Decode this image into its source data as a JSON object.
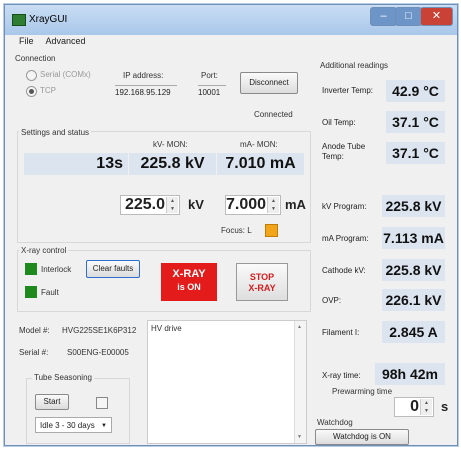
{
  "window": {
    "title": "XrayGUI"
  },
  "menu": {
    "file": "File",
    "advanced": "Advanced"
  },
  "connection": {
    "group_label": "Connection",
    "serial_label": "Serial (COMx)",
    "tcp_label": "TCP",
    "ip_label": "IP address:",
    "ip_value": "192.168.95.129",
    "port_label": "Port:",
    "port_value": "10001",
    "disconnect_label": "Disconnect",
    "status": "Connected"
  },
  "settings": {
    "group_label": "Settings and status",
    "kv_mon_label": "kV- MON:",
    "ma_mon_label": "mA- MON:",
    "time_value": "13s",
    "kv_mon_value": "225.8 kV",
    "ma_mon_value": "7.010 mA",
    "kv_set_value": "225.0",
    "kv_unit": "kV",
    "ma_set_value": "7.000",
    "ma_unit": "mA",
    "focus_label": "Focus: L",
    "focus_color": "#f2a51a"
  },
  "xray_control": {
    "group_label": "X-ray control",
    "interlock_label": "Interlock",
    "fault_label": "Fault",
    "clear_faults_label": "Clear faults",
    "xray_on_line1": "X-RAY",
    "xray_on_line2": "is ON",
    "stop_line1": "STOP",
    "stop_line2": "X-RAY",
    "led_color": "#1e8a1e",
    "on_color": "#e41b1b"
  },
  "model": {
    "model_label": "Model #:",
    "model_value": "HVG225SE1K6P312",
    "serial_label": "Serial #:",
    "serial_value": "S00ENG-E00005",
    "hv_drive_label": "HV drive"
  },
  "tube_seasoning": {
    "group_label": "Tube Seasoning",
    "start_label": "Start",
    "select_value": "Idle 3 - 30 days"
  },
  "readings": {
    "group_label": "Additional readings",
    "inverter_temp_label": "Inverter Temp:",
    "inverter_temp_value": "42.9 °C",
    "oil_temp_label": "Oil Temp:",
    "oil_temp_value": "37.1 °C",
    "anode_temp_label": "Anode Tube Temp:",
    "anode_temp_value": "37.1 °C",
    "kv_program_label": "kV Program:",
    "kv_program_value": "225.8 kV",
    "ma_program_label": "mA Program:",
    "ma_program_value": "7.113 mA",
    "cathode_kv_label": "Cathode kV:",
    "cathode_kv_value": "225.8 kV",
    "ovp_label": "OVP:",
    "ovp_value": "226.1 kV",
    "filament_label": "Filament I:",
    "filament_value": "2.845 A",
    "xray_time_label": "X-ray time:",
    "xray_time_value": "98h 42m",
    "prewarming_label": "Prewarming time",
    "prewarming_value": "0",
    "prewarming_unit": "s"
  },
  "watchdog": {
    "group_label": "Watchdog",
    "button_label": "Watchdog is ON"
  }
}
